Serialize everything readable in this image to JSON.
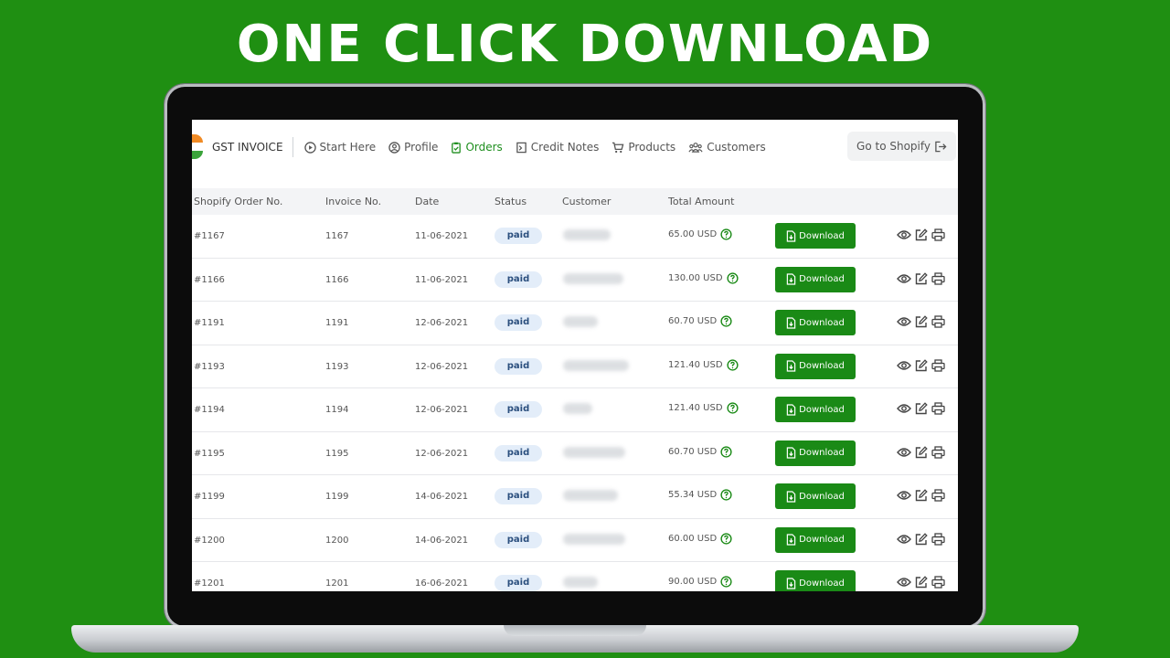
{
  "headline": "ONE CLICK DOWNLOAD",
  "colors": {
    "background": "#1f8f12",
    "accent": "#1a8a16",
    "badge_bg": "#e3edf9"
  },
  "nav": {
    "brand": "GST INVOICE",
    "items": [
      {
        "label": "Start Here",
        "icon": "play-circle-icon"
      },
      {
        "label": "Profile",
        "icon": "user-circle-icon"
      },
      {
        "label": "Orders",
        "icon": "clipboard-check-icon",
        "active": true
      },
      {
        "label": "Credit Notes",
        "icon": "note-icon"
      },
      {
        "label": "Products",
        "icon": "cart-icon"
      },
      {
        "label": "Customers",
        "icon": "users-icon"
      }
    ],
    "shopify_button": "Go to Shopify"
  },
  "table": {
    "headers": [
      "Shopify Order No.",
      "Invoice No.",
      "Date",
      "Status",
      "Customer",
      "Total Amount"
    ],
    "download_label": "Download",
    "rows": [
      {
        "order": "#1167",
        "invoice": "1167",
        "date": "11-06-2021",
        "status": "paid",
        "amount": "65.00 USD"
      },
      {
        "order": "#1166",
        "invoice": "1166",
        "date": "11-06-2021",
        "status": "paid",
        "amount": "130.00 USD"
      },
      {
        "order": "#1191",
        "invoice": "1191",
        "date": "12-06-2021",
        "status": "paid",
        "amount": "60.70 USD"
      },
      {
        "order": "#1193",
        "invoice": "1193",
        "date": "12-06-2021",
        "status": "paid",
        "amount": "121.40 USD"
      },
      {
        "order": "#1194",
        "invoice": "1194",
        "date": "12-06-2021",
        "status": "paid",
        "amount": "121.40 USD"
      },
      {
        "order": "#1195",
        "invoice": "1195",
        "date": "12-06-2021",
        "status": "paid",
        "amount": "60.70 USD"
      },
      {
        "order": "#1199",
        "invoice": "1199",
        "date": "14-06-2021",
        "status": "paid",
        "amount": "55.34 USD"
      },
      {
        "order": "#1200",
        "invoice": "1200",
        "date": "14-06-2021",
        "status": "paid",
        "amount": "60.00 USD"
      },
      {
        "order": "#1201",
        "invoice": "1201",
        "date": "16-06-2021",
        "status": "paid",
        "amount": "90.00 USD"
      }
    ]
  }
}
